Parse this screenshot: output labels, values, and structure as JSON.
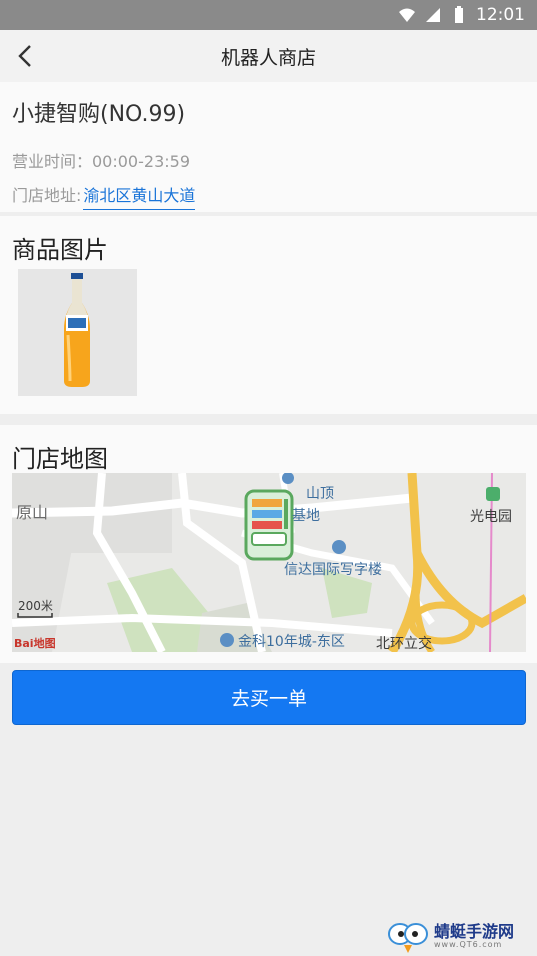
{
  "status_bar": {
    "time": "12:01"
  },
  "header": {
    "title": "机器人商店"
  },
  "store": {
    "name": "小捷智购(NO.99)",
    "hours": "营业时间：00:00-23:59",
    "address_label": "门店地址:",
    "address_value": "渝北区黄山大道"
  },
  "images_section": {
    "title": "商品图片"
  },
  "map_section": {
    "title": "门店地图",
    "labels": {
      "yuanshan": "原山",
      "shanding_1": "山顶",
      "shanding_2": "基地",
      "xinda": "信达国际写字楼",
      "guangdianyuan": "光电园",
      "jinke": "金科10年城-东区",
      "beihuan": "北环立交",
      "scale": "200米",
      "baidu_logo": "Bai地图"
    }
  },
  "buy_button": {
    "label": "去买一单"
  },
  "watermark": {
    "name": "蜻蜓手游网",
    "url": "www.QT6.com"
  },
  "colors": {
    "accent": "#1478f2",
    "link": "#1a74d8",
    "highway": "#f2c24b"
  }
}
